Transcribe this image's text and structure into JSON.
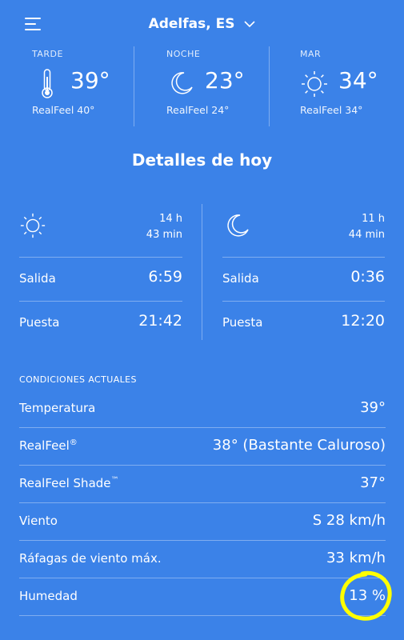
{
  "header": {
    "menu_icon": "hamburger-icon",
    "location": "Adelfas, ES"
  },
  "forecast": [
    {
      "label": "TARDE",
      "temp": "39°",
      "realfeel": "RealFeel 40°",
      "icon": "thermometer-icon"
    },
    {
      "label": "NOCHE",
      "temp": "23°",
      "realfeel": "RealFeel 24°",
      "icon": "moon-icon"
    },
    {
      "label": "MAR",
      "temp": "34°",
      "realfeel": "RealFeel 34°",
      "icon": "sun-icon"
    }
  ],
  "details_title": "Detalles de hoy",
  "sun": {
    "duration_h": "14 h",
    "duration_m": "43 min",
    "rise_label": "Salida",
    "rise_value": "6:59",
    "set_label": "Puesta",
    "set_value": "21:42"
  },
  "moon": {
    "duration_h": "11 h",
    "duration_m": "44 min",
    "rise_label": "Salida",
    "rise_value": "0:36",
    "set_label": "Puesta",
    "set_value": "12:20"
  },
  "conditions": {
    "title": "CONDICIONES ACTUALES",
    "rows": [
      {
        "label": "Temperatura",
        "sup": "",
        "value": "39°"
      },
      {
        "label": "RealFeel",
        "sup": "®",
        "value": "38° (Bastante Caluroso)"
      },
      {
        "label": "RealFeel Shade",
        "sup": "™",
        "value": "37°"
      },
      {
        "label": "Viento",
        "sup": "",
        "value": "S 28 km/h"
      },
      {
        "label": "Ráfagas de viento máx.",
        "sup": "",
        "value": "33 km/h"
      },
      {
        "label": "Humedad",
        "sup": "",
        "value": "13 %"
      }
    ]
  },
  "colors": {
    "background": "#3b82e8",
    "highlight": "#ffff00"
  }
}
